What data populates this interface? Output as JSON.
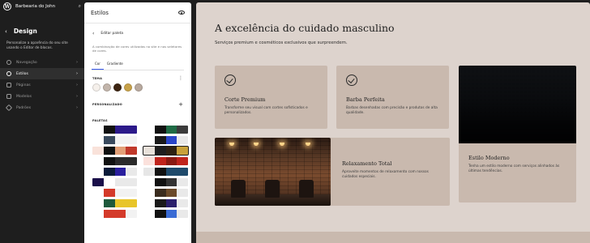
{
  "topbar": {
    "site_name": "Barbearia do John",
    "logo": "wordpress-logo",
    "search_icon": "search-icon"
  },
  "design": {
    "title": "Design",
    "description": "Personalize a aparência do seu site usando o Editor de blocos.",
    "nav": [
      {
        "label": "Navegação",
        "icon": "navigation-icon",
        "active": false
      },
      {
        "label": "Estilos",
        "icon": "styles-icon",
        "active": true
      },
      {
        "label": "Páginas",
        "icon": "pages-icon",
        "active": false
      },
      {
        "label": "Modelos",
        "icon": "templates-icon",
        "active": false
      },
      {
        "label": "Padrões",
        "icon": "patterns-icon",
        "active": false
      }
    ]
  },
  "panel": {
    "title": "Estilos",
    "subtitle": "Editar paleta",
    "description": "A combinação de cores utilizadas no site e nos seletores de cores.",
    "tabs": [
      "Cor",
      "Gradiente"
    ],
    "theme_label": "TEMA",
    "custom_label": "PERSONALIZADO",
    "palettes_label": "PALETAS",
    "theme_colors": [
      "#f5f0eb",
      "#c2b5ab",
      "#3d2512",
      "#c8a24a",
      "#b8a99e"
    ],
    "palettes": [
      [
        [
          "#ffffff",
          "#111111",
          "#2c1a8a",
          "#2c1a8a"
        ],
        [
          "#ffffff",
          "#111111",
          "#1f6b45",
          "#3b3b3b"
        ]
      ],
      [
        [
          "#ffffff",
          "#3a4a5e",
          "#f2f2f2",
          "#f2f2f2"
        ],
        [
          "#ffffff",
          "#1a1a1a",
          "#2a46c8",
          "#e9e9e9"
        ]
      ],
      [
        [
          "#f9e2da",
          "#111111",
          "#e3a078",
          "#c0392b"
        ],
        [
          "#e8e1da",
          "#1e1e1e",
          "#2d2112",
          "#c8a13a"
        ]
      ],
      [
        [
          "#ffffff",
          "#111111",
          "#2a2a2a",
          "#2a2a2a"
        ],
        [
          "#fbe1dc",
          "#c0241c",
          "#8a1a12",
          "#c0241c"
        ]
      ],
      [
        [
          "#ffffff",
          "#0b1b3a",
          "#2a1f9e",
          "#e9e9e9"
        ],
        [
          "#e6e6e6",
          "#111111",
          "#1f4a6b",
          "#1f4a6b"
        ]
      ],
      [
        [
          "#1a0f4a",
          "#ffffff",
          "#e9e9e9",
          "#e9e9e9"
        ],
        [
          "#ffffff",
          "#111111",
          "#333333",
          "#e9e9e9"
        ]
      ],
      [
        [
          "#ffffff",
          "#d43a2a",
          "#f2f2f2",
          "#f2f2f2"
        ],
        [
          "#ffffff",
          "#3a2c1e",
          "#6b4a2a",
          "#e9e9e9"
        ]
      ],
      [
        [
          "#ffffff",
          "#1e5a3c",
          "#e8c52a",
          "#e8c52a"
        ],
        [
          "#ffffff",
          "#1a1a1a",
          "#2a1f6b",
          "#e9e9e9"
        ]
      ],
      [
        [
          "#ffffff",
          "#d43a2a",
          "#d43a2a",
          "#f2f2f2"
        ],
        [
          "#ffffff",
          "#111111",
          "#3a6bd4",
          "#e9e9e9"
        ]
      ]
    ],
    "selected_palette": "2-1"
  },
  "canvas": {
    "heading": "A excelência do cuidado masculino",
    "subheading": "Serviços premium e cosméticos exclusivos que surpreendem.",
    "cards": [
      {
        "title": "Corte Premium",
        "text": "Transforme seu visual com cortes sofisticados e personalizados."
      },
      {
        "title": "Barba Perfeita",
        "text": "Barbas desenhadas com precisão e produtos de alta qualidade."
      },
      {
        "title": "Relaxamento Total",
        "text": "Aproveite momentos de relaxamento com nossos cuidados especiais."
      },
      {
        "title": "Estilo Moderno",
        "text": "Tenha um estilo moderno com serviços alinhados às últimas tendências."
      }
    ],
    "background_color": "#ddd3cd",
    "card_color": "#c9b9ae"
  }
}
